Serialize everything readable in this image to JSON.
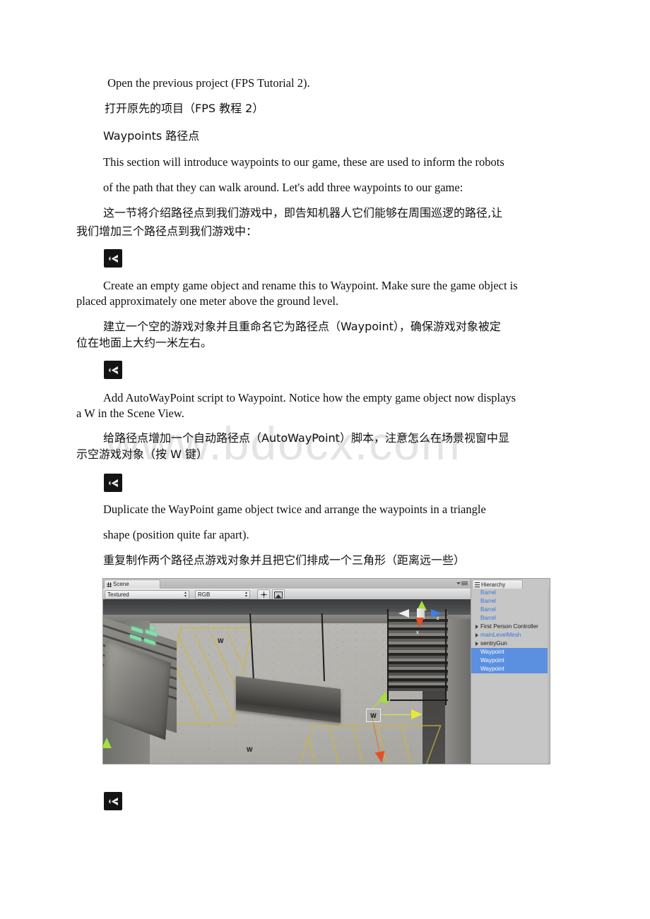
{
  "document": {
    "watermark": "www.bdocx.com",
    "paragraphs": [
      {
        "id": "p1",
        "lang": "en",
        "text": " Open the previous project (FPS Tutorial 2)."
      },
      {
        "id": "p2",
        "lang": "cn",
        "text": "打开原先的项目（FPS 教程 2）"
      },
      {
        "id": "p3",
        "lang": "cn",
        "text": "Waypoints 路径点"
      },
      {
        "id": "p4",
        "lang": "en",
        "text": "This section will introduce waypoints to our game, these are used to inform the robots"
      },
      {
        "id": "p5",
        "lang": "en",
        "text": "of the path that they can walk around. Let's add three waypoints to our game:"
      },
      {
        "id": "p6",
        "lang": "cn",
        "text": "这一节将介绍路径点到我们游戏中，即告知机器人它们能够在周围巡逻的路径,让"
      },
      {
        "id": "p7",
        "lang": "cn",
        "text": "我们增加三个路径点到我们游戏中："
      },
      {
        "id": "p8",
        "lang": "en",
        "text": "Create an empty game object and rename this to Waypoint. Make sure the game object is"
      },
      {
        "id": "p9",
        "lang": "en",
        "text": "placed approximately one meter above the ground level."
      },
      {
        "id": "p10",
        "lang": "cn",
        "text": "建立一个空的游戏对象并且重命名它为路径点（Waypoint），确保游戏对象被定"
      },
      {
        "id": "p11",
        "lang": "cn",
        "text": "位在地面上大约一米左右。"
      },
      {
        "id": "p12",
        "lang": "en",
        "text": "Add AutoWayPoint script to Waypoint. Notice how the empty game object now displays"
      },
      {
        "id": "p13",
        "lang": "en",
        "text": "a W in the Scene View."
      },
      {
        "id": "p14",
        "lang": "cn",
        "text": "给路径点增加一个自动路径点（AutoWayPoint）脚本，注意怎么在场景视窗中显"
      },
      {
        "id": "p15",
        "lang": "cn",
        "text": "示空游戏对象（按 W 键）"
      },
      {
        "id": "p16",
        "lang": "en",
        "text": "Duplicate the WayPoint game object twice and arrange the waypoints in a triangle"
      },
      {
        "id": "p17",
        "lang": "en",
        "text": "shape (position quite far apart)."
      },
      {
        "id": "p18",
        "lang": "cn",
        "text": "重复制作两个路径点游戏对象并且把它们排成一个三角形（距离远一些）"
      }
    ],
    "unity_bullets": [
      {
        "id": "b1",
        "icon": "unity-logo-icon"
      },
      {
        "id": "b2",
        "icon": "unity-logo-icon"
      },
      {
        "id": "b3",
        "icon": "unity-logo-icon"
      },
      {
        "id": "b4",
        "icon": "unity-logo-icon"
      }
    ]
  },
  "unity_editor": {
    "scene_panel": {
      "tab_label": "Scene",
      "tab_icon": "grid-icon",
      "menu_icon": "panel-menu-icon",
      "toolbar": {
        "draw_mode": "Textured",
        "render_mode": "RGB",
        "light_toggle_icon": "sun-icon",
        "effects_toggle_icon": "image-icon"
      },
      "viewport": {
        "waypoint_labels": [
          "W",
          "W",
          "W"
        ],
        "selected_waypoint_label": "W",
        "gizmo_axis_labels": [
          "z",
          "x"
        ],
        "axis_colors": {
          "x": "#e2502a",
          "y": "#a6e03a",
          "z": "#3a7fe2",
          "selected": "#e8e83a"
        }
      }
    },
    "hierarchy_panel": {
      "tab_label": "Hierarchy",
      "tab_icon": "list-icon",
      "selection_color": "#5b8fe0",
      "prefab_color": "#3b74d4",
      "items": [
        {
          "name": "Barrel",
          "kind": "prefab",
          "expandable": false,
          "selected": false
        },
        {
          "name": "Barrel",
          "kind": "prefab",
          "expandable": false,
          "selected": false
        },
        {
          "name": "Barrel",
          "kind": "prefab",
          "expandable": false,
          "selected": false
        },
        {
          "name": "Barrel",
          "kind": "prefab",
          "expandable": false,
          "selected": false
        },
        {
          "name": "First Person Controller",
          "kind": "normal",
          "expandable": true,
          "selected": false
        },
        {
          "name": "mainLevelMesh",
          "kind": "prefab",
          "expandable": true,
          "selected": false
        },
        {
          "name": "sentryGun",
          "kind": "normal",
          "expandable": true,
          "selected": false
        },
        {
          "name": "Waypoint",
          "kind": "prefab",
          "expandable": false,
          "selected": true
        },
        {
          "name": "Waypoint",
          "kind": "prefab",
          "expandable": false,
          "selected": true
        },
        {
          "name": "Waypoint",
          "kind": "prefab",
          "expandable": false,
          "selected": true
        }
      ]
    }
  }
}
